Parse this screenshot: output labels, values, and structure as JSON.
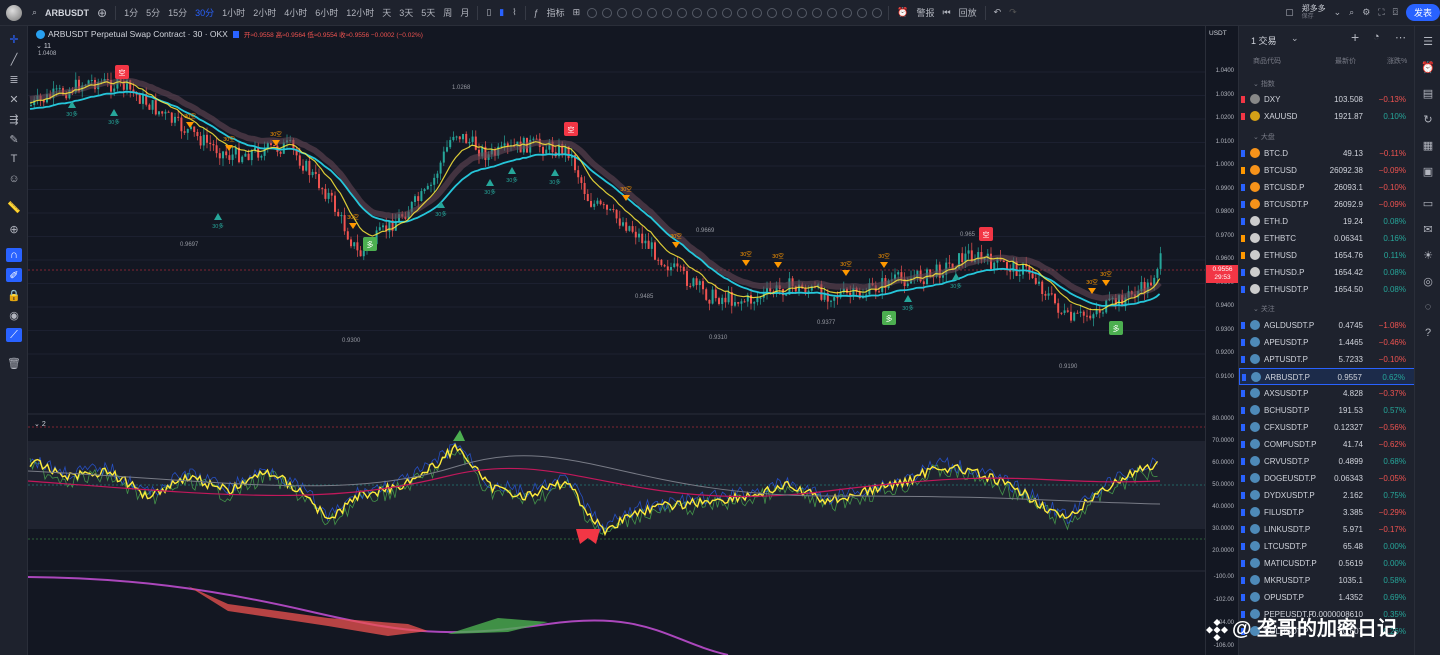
{
  "toolbar": {
    "symbol": "ARBUSDT",
    "intervals": [
      "1分",
      "5分",
      "15分",
      "30分",
      "1小时",
      "2小时",
      "4小时",
      "6小时",
      "12小时",
      "天",
      "3天",
      "5天",
      "周",
      "月"
    ],
    "active_interval": "30分",
    "indicators_label": "指标",
    "alert_label": "警报",
    "replay_label": "回放",
    "user_name": "郑多多",
    "user_sub": "保存",
    "publish_label": "发表"
  },
  "legend": {
    "title": "ARBUSDT Perpetual Swap Contract · 30 · OKX",
    "ohlc": "开≈0.9558 高≈0.9564 低≈0.9554 收≈0.9556 −0.0002 (−0.02%)",
    "indicator1_label": "11",
    "indicator2_label": "2",
    "top_price": "1.0408"
  },
  "price_axis": {
    "currency": "USDT",
    "labels": [
      "1.0400",
      "1.0300",
      "1.0200",
      "1.0100",
      "1.0000",
      "0.9900",
      "0.9800",
      "0.9700",
      "0.9600",
      "0.9500",
      "0.9400",
      "0.9300",
      "0.9200",
      "0.9100"
    ],
    "current_price": "0.9556",
    "countdown": "29:53",
    "osc_labels": [
      "80.0000",
      "70.0000",
      "60.0000",
      "50.0000",
      "40.0000",
      "30.0000",
      "20.0000"
    ],
    "mom_labels": [
      "-100.00",
      "-102.00",
      "-104.00",
      "-106.00"
    ]
  },
  "annotations": [
    "1.0268",
    "0.9697",
    "0.9300",
    "0.9485",
    "0.9310",
    "0.9377",
    "0.9669",
    "0.965",
    "0.9190"
  ],
  "signals": {
    "sell": "空",
    "buy": "多",
    "short_label": "30空",
    "long_label": "30多"
  },
  "watchlist": {
    "list_name": "1 交易",
    "col_symbol": "商品代码",
    "col_last": "最新价",
    "col_change": "涨跌%",
    "sections": [
      "指数",
      "大盘",
      "关注"
    ],
    "rows": [
      {
        "symbol": "DXY",
        "last": "103.508",
        "change": "−0.13%",
        "dir": "down"
      },
      {
        "symbol": "XAUUSD",
        "last": "1921.87",
        "change": "0.10%",
        "dir": "up"
      },
      {
        "symbol": "BTC.D",
        "last": "49.13",
        "change": "−0.11%",
        "dir": "down"
      },
      {
        "symbol": "BTCUSD",
        "last": "26092.38",
        "change": "−0.09%",
        "dir": "down"
      },
      {
        "symbol": "BTCUSD.P",
        "last": "26093.1",
        "change": "−0.10%",
        "dir": "down"
      },
      {
        "symbol": "BTCUSDT.P",
        "last": "26092.9",
        "change": "−0.09%",
        "dir": "down"
      },
      {
        "symbol": "ETH.D",
        "last": "19.24",
        "change": "0.08%",
        "dir": "up"
      },
      {
        "symbol": "ETHBTC",
        "last": "0.06341",
        "change": "0.16%",
        "dir": "up"
      },
      {
        "symbol": "ETHUSD",
        "last": "1654.76",
        "change": "0.11%",
        "dir": "up"
      },
      {
        "symbol": "ETHUSD.P",
        "last": "1654.42",
        "change": "0.08%",
        "dir": "up"
      },
      {
        "symbol": "ETHUSDT.P",
        "last": "1654.50",
        "change": "0.08%",
        "dir": "up"
      },
      {
        "symbol": "AGLDUSDT.P",
        "last": "0.4745",
        "change": "−1.08%",
        "dir": "down"
      },
      {
        "symbol": "APEUSDT.P",
        "last": "1.4465",
        "change": "−0.46%",
        "dir": "down"
      },
      {
        "symbol": "APTUSDT.P",
        "last": "5.7233",
        "change": "−0.10%",
        "dir": "down"
      },
      {
        "symbol": "ARBUSDT.P",
        "last": "0.9557",
        "change": "0.62%",
        "dir": "up"
      },
      {
        "symbol": "AXSUSDT.P",
        "last": "4.828",
        "change": "−0.37%",
        "dir": "down"
      },
      {
        "symbol": "BCHUSDT.P",
        "last": "191.53",
        "change": "0.57%",
        "dir": "up"
      },
      {
        "symbol": "CFXUSDT.P",
        "last": "0.12327",
        "change": "−0.56%",
        "dir": "down"
      },
      {
        "symbol": "COMPUSDT.P",
        "last": "41.74",
        "change": "−0.62%",
        "dir": "down"
      },
      {
        "symbol": "CRVUSDT.P",
        "last": "0.4899",
        "change": "0.68%",
        "dir": "up"
      },
      {
        "symbol": "DOGEUSDT.P",
        "last": "0.06343",
        "change": "−0.05%",
        "dir": "down"
      },
      {
        "symbol": "DYDXUSDT.P",
        "last": "2.162",
        "change": "0.75%",
        "dir": "up"
      },
      {
        "symbol": "FILUSDT.P",
        "last": "3.385",
        "change": "−0.29%",
        "dir": "down"
      },
      {
        "symbol": "LINKUSDT.P",
        "last": "5.971",
        "change": "−0.17%",
        "dir": "down"
      },
      {
        "symbol": "LTCUSDT.P",
        "last": "65.48",
        "change": "0.00%",
        "dir": "up"
      },
      {
        "symbol": "MATICUSDT.P",
        "last": "0.5619",
        "change": "0.00%",
        "dir": "up"
      },
      {
        "symbol": "MKRUSDT.P",
        "last": "1035.1",
        "change": "0.58%",
        "dir": "up"
      },
      {
        "symbol": "OPUSDT.P",
        "last": "1.4352",
        "change": "0.69%",
        "dir": "up"
      },
      {
        "symbol": "PEPEUSDT.P",
        "last": "0.0000008610",
        "change": "0.35%",
        "dir": "up"
      },
      {
        "symbol": "SOLUSDT.P",
        "last": "20.607",
        "change": "0.26%",
        "dir": "up"
      }
    ]
  },
  "watermark": "@ 垄哥的加密日记",
  "colors": {
    "up": "#26a69a",
    "down": "#ef5350",
    "accent": "#2962ff",
    "signal_green": "#4caf50",
    "signal_red": "#f23645",
    "signal_orange": "#ff9800",
    "osc_yellow": "#ffeb3b",
    "ma_teal": "#26c6da",
    "bg": "#131722"
  }
}
